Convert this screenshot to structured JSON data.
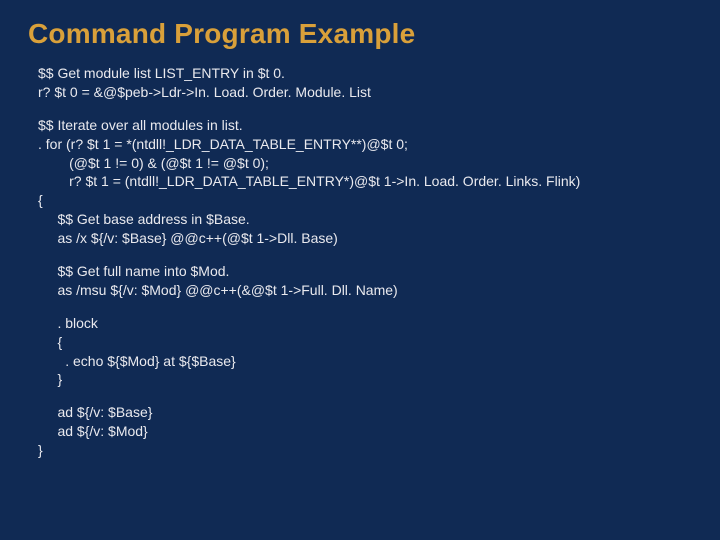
{
  "title": "Command Program Example",
  "code": {
    "block1": "$$ Get module list LIST_ENTRY in $t 0.\nr? $t 0 = &@$peb->Ldr->In. Load. Order. Module. List",
    "block2": "$$ Iterate over all modules in list.\n. for (r? $t 1 = *(ntdll!_LDR_DATA_TABLE_ENTRY**)@$t 0;\n        (@$t 1 != 0) & (@$t 1 != @$t 0);\n        r? $t 1 = (ntdll!_LDR_DATA_TABLE_ENTRY*)@$t 1->In. Load. Order. Links. Flink)\n{\n     $$ Get base address in $Base.\n     as /x ${/v: $Base} @@c++(@$t 1->Dll. Base)",
    "block3": "     $$ Get full name into $Mod.\n     as /msu ${/v: $Mod} @@c++(&@$t 1->Full. Dll. Name)",
    "block4": "     . block\n     {\n       . echo ${$Mod} at ${$Base}\n     }",
    "block5": "     ad ${/v: $Base}\n     ad ${/v: $Mod}\n}"
  }
}
